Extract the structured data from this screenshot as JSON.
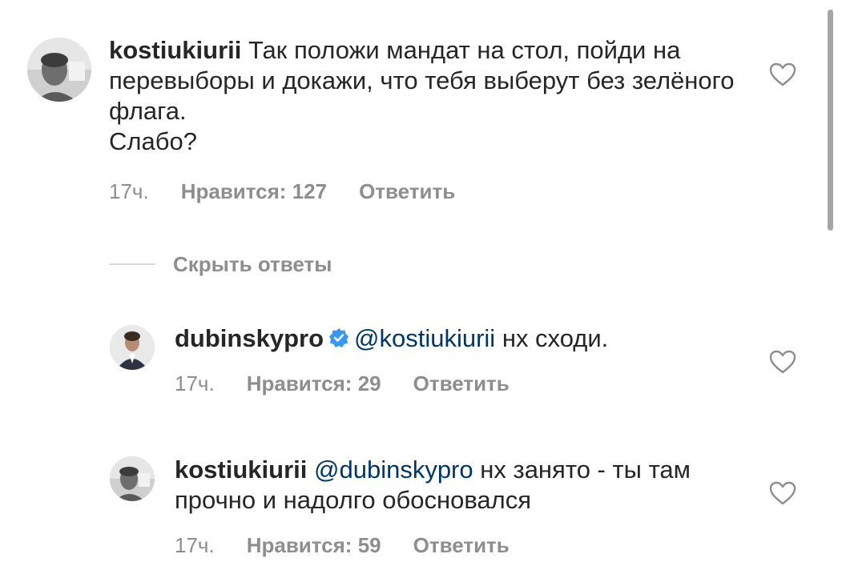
{
  "comments": [
    {
      "username": "kostiukiurii",
      "text": "Так положи мандат на стол,  пойди на перевыборы и докажи, что тебя выберут без зелёного флага.",
      "text2": "Слабо?",
      "time": "17ч.",
      "likes": "Нравится: 127",
      "reply": "Ответить"
    }
  ],
  "hide_replies": "Скрыть ответы",
  "replies": [
    {
      "username": "dubinskypro",
      "verified": true,
      "mention": "@kostiukiurii",
      "text": "нх сходи.",
      "time": "17ч.",
      "likes": "Нравится: 29",
      "reply": "Ответить"
    },
    {
      "username": "kostiukiurii",
      "mention": "@dubinskypro",
      "text": "нх занято - ты там прочно и надолго обосновался",
      "time": "17ч.",
      "likes": "Нравится: 59",
      "reply": "Ответить"
    }
  ],
  "colors": {
    "text": "#262626",
    "meta": "#8e8e8e",
    "mention": "#00376b",
    "verified": "#3897f0"
  },
  "icons": {
    "like": "heart-outline-icon",
    "verified": "verified-badge-icon"
  }
}
